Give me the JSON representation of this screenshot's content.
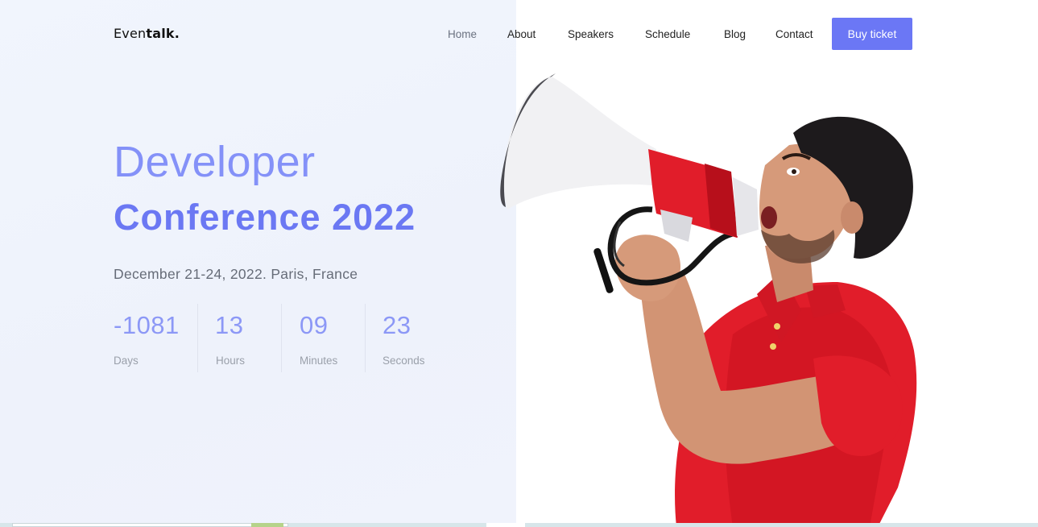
{
  "brand": {
    "logo_light": "Even",
    "logo_bold": "talk."
  },
  "nav": {
    "items": [
      {
        "label": "Home",
        "active": true
      },
      {
        "label": "About",
        "active": false
      },
      {
        "label": "Speakers",
        "active": false
      },
      {
        "label": "Schedule",
        "active": false
      },
      {
        "label": "Blog",
        "active": false
      },
      {
        "label": "Contact",
        "active": false
      }
    ],
    "cta_label": "Buy ticket"
  },
  "hero": {
    "title_line1": "Developer",
    "title_line2": "Conference 2022",
    "date_location": "December 21-24, 2022. Paris, France"
  },
  "countdown": [
    {
      "value": "-1081",
      "label": "Days"
    },
    {
      "value": "13",
      "label": "Hours"
    },
    {
      "value": "09",
      "label": "Minutes"
    },
    {
      "value": "23",
      "label": "Seconds"
    }
  ],
  "colors": {
    "accent": "#6b77f5",
    "title_light": "#7f8cf8",
    "title_bold": "#6b78f3",
    "left_panel_bg": "#f0f4fc"
  },
  "icons": {
    "hero_image": "man-shouting-into-megaphone"
  }
}
